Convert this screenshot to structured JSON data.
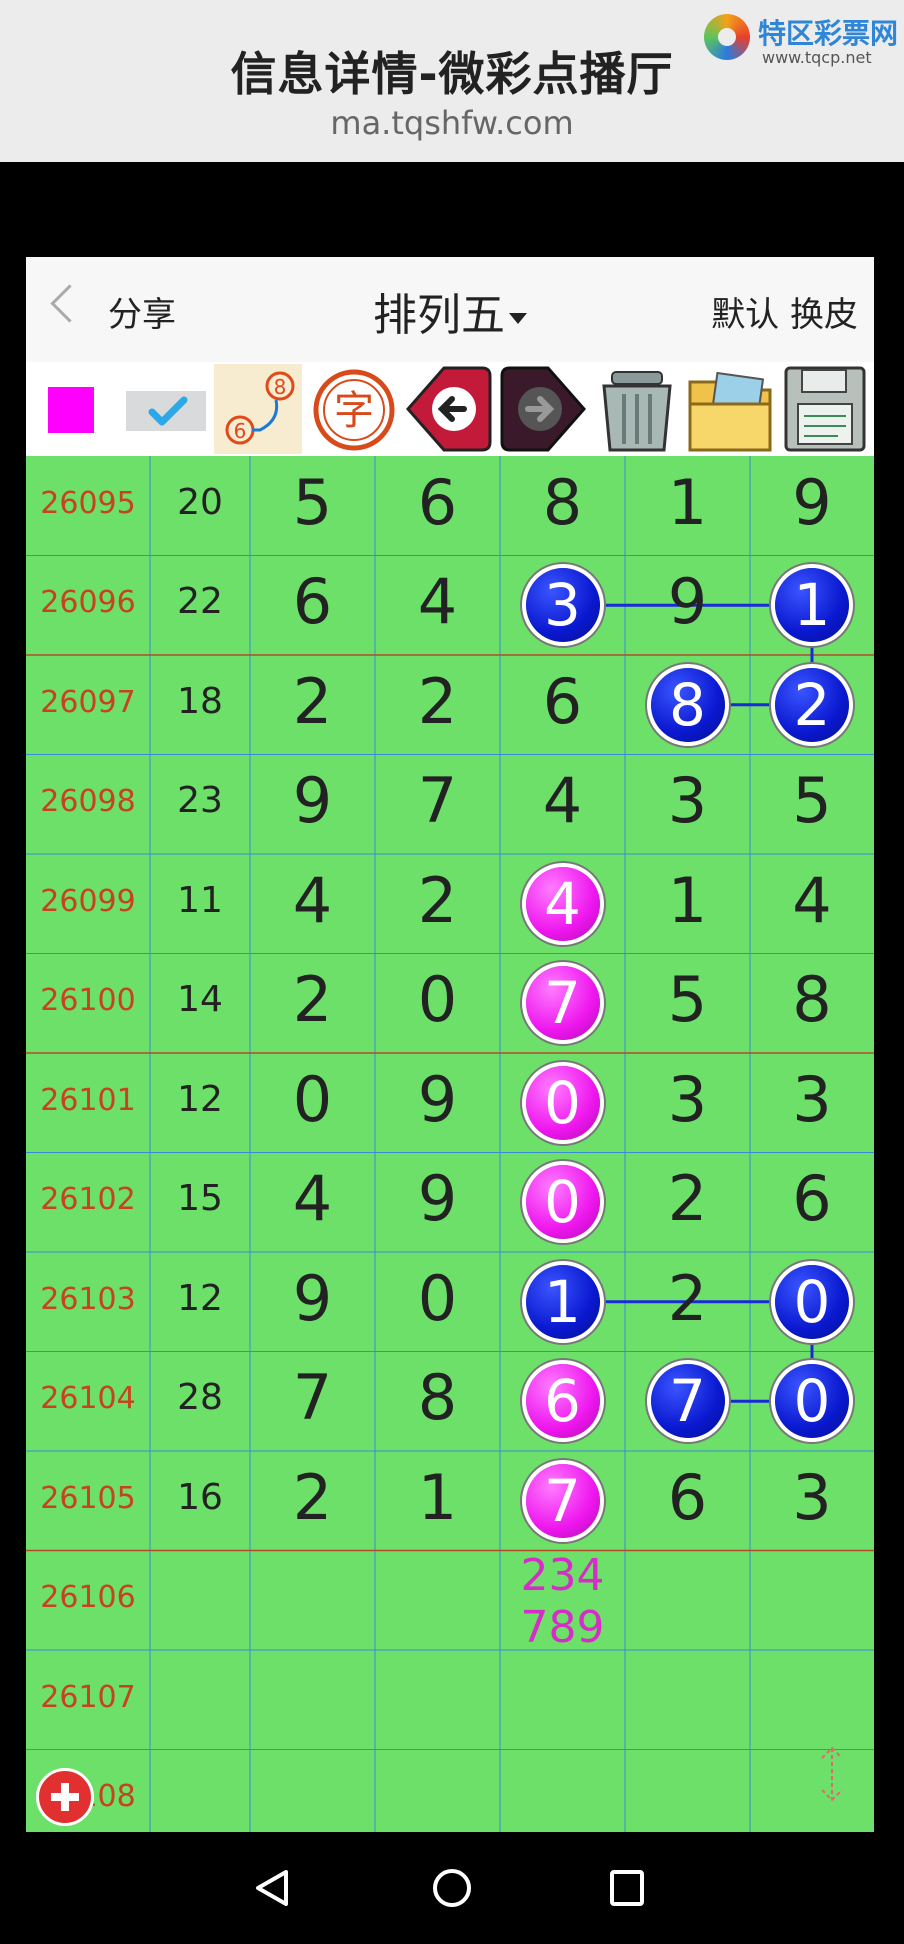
{
  "page": {
    "title": "信息详情-微彩点播厅",
    "url": "ma.tqshfw.com",
    "logo_name": "特区彩票网",
    "logo_site": "www.tqcp.net"
  },
  "app": {
    "back_label": "分享",
    "title": "排列五",
    "right_label": "默认 换皮"
  },
  "toolbar": [
    {
      "icon": "magenta-square-icon"
    },
    {
      "icon": "checkmark-icon"
    },
    {
      "icon": "connect-dots-icon",
      "text": "8",
      "text2": "6"
    },
    {
      "icon": "character-icon",
      "text": "字"
    },
    {
      "icon": "left-arrow-icon"
    },
    {
      "icon": "right-arrow-icon"
    },
    {
      "icon": "trash-can-icon"
    },
    {
      "icon": "folder-photo-icon"
    },
    {
      "icon": "floppy-disk-icon"
    }
  ],
  "colors": {
    "grid_bg": "#6de06a",
    "issue_text": "#c6431b",
    "blue_ball": "#0a18cf",
    "pink_ball": "#ee16ee",
    "prediction": "#d82cc8"
  },
  "rows": [
    {
      "issue": "26095",
      "sum": "20",
      "digits": [
        "5",
        "6",
        "8",
        "1",
        "9"
      ]
    },
    {
      "issue": "26096",
      "sum": "22",
      "digits": [
        "6",
        "4",
        "3",
        "9",
        "1"
      ]
    },
    {
      "issue": "26097",
      "sum": "18",
      "digits": [
        "2",
        "2",
        "6",
        "8",
        "2"
      ]
    },
    {
      "issue": "26098",
      "sum": "23",
      "digits": [
        "9",
        "7",
        "4",
        "3",
        "5"
      ]
    },
    {
      "issue": "26099",
      "sum": "11",
      "digits": [
        "4",
        "2",
        "4",
        "1",
        "4"
      ]
    },
    {
      "issue": "26100",
      "sum": "14",
      "digits": [
        "2",
        "0",
        "7",
        "5",
        "8"
      ]
    },
    {
      "issue": "26101",
      "sum": "12",
      "digits": [
        "0",
        "9",
        "0",
        "3",
        "3"
      ]
    },
    {
      "issue": "26102",
      "sum": "15",
      "digits": [
        "4",
        "9",
        "0",
        "2",
        "6"
      ]
    },
    {
      "issue": "26103",
      "sum": "12",
      "digits": [
        "9",
        "0",
        "1",
        "2",
        "0"
      ]
    },
    {
      "issue": "26104",
      "sum": "28",
      "digits": [
        "7",
        "8",
        "6",
        "7",
        "0"
      ]
    },
    {
      "issue": "26105",
      "sum": "16",
      "digits": [
        "2",
        "1",
        "7",
        "6",
        "3"
      ]
    },
    {
      "issue": "26106",
      "sum": "",
      "digits": [
        "",
        "",
        "",
        "",
        ""
      ],
      "prediction": {
        "col": 2,
        "line1": "234",
        "line2": "789"
      }
    },
    {
      "issue": "26107",
      "sum": "",
      "digits": [
        "",
        "",
        "",
        "",
        ""
      ]
    },
    {
      "issue": "26108",
      "sum": "",
      "digits": [
        "",
        "",
        "",
        "",
        ""
      ]
    }
  ],
  "marks": [
    {
      "row": 1,
      "col": 2,
      "color": "blue"
    },
    {
      "row": 1,
      "col": 4,
      "color": "blue"
    },
    {
      "row": 2,
      "col": 3,
      "color": "blue"
    },
    {
      "row": 2,
      "col": 4,
      "color": "blue"
    },
    {
      "row": 4,
      "col": 2,
      "color": "pink"
    },
    {
      "row": 5,
      "col": 2,
      "color": "pink"
    },
    {
      "row": 6,
      "col": 2,
      "color": "pink"
    },
    {
      "row": 7,
      "col": 2,
      "color": "pink"
    },
    {
      "row": 8,
      "col": 2,
      "color": "blue"
    },
    {
      "row": 8,
      "col": 4,
      "color": "blue"
    },
    {
      "row": 9,
      "col": 2,
      "color": "pink"
    },
    {
      "row": 9,
      "col": 3,
      "color": "blue"
    },
    {
      "row": 9,
      "col": 4,
      "color": "blue"
    },
    {
      "row": 10,
      "col": 2,
      "color": "pink"
    }
  ],
  "connections": [
    {
      "from": [
        1,
        2
      ],
      "to": [
        1,
        4
      ]
    },
    {
      "from": [
        1,
        4
      ],
      "to": [
        2,
        4
      ]
    },
    {
      "from": [
        2,
        3
      ],
      "to": [
        2,
        4
      ]
    },
    {
      "from": [
        8,
        2
      ],
      "to": [
        8,
        4
      ]
    },
    {
      "from": [
        8,
        4
      ],
      "to": [
        9,
        4
      ]
    },
    {
      "from": [
        9,
        3
      ],
      "to": [
        9,
        4
      ]
    }
  ],
  "separators_after_rows": [
    1,
    5,
    10
  ]
}
